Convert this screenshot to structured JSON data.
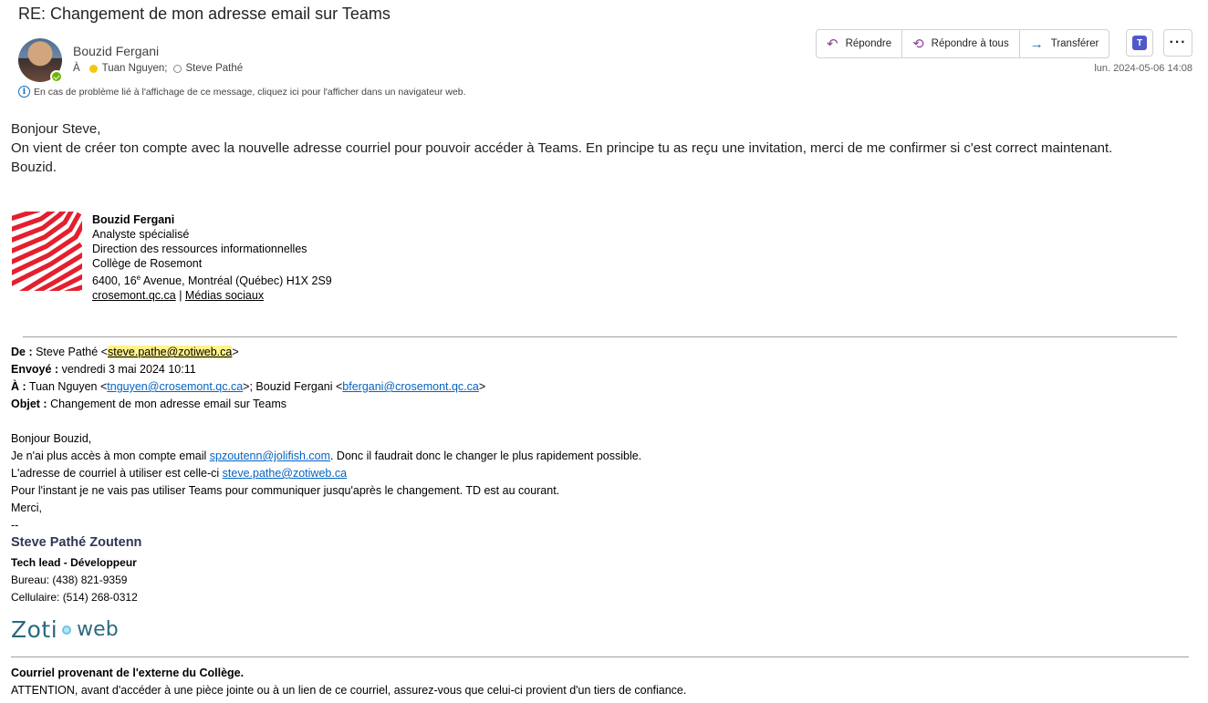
{
  "email": {
    "subject": "RE: Changement de mon adresse email sur Teams",
    "sender_name": "Bouzid Fergani",
    "to_label": "À",
    "recipients": [
      "Tuan Nguyen;",
      "Steve Pathé"
    ],
    "date": "lun. 2024-05-06 14:08",
    "info_banner": "En cas de problème lié à l'affichage de ce message, cliquez ici pour l'afficher dans un navigateur web."
  },
  "actions": {
    "reply": "Répondre",
    "reply_all": "Répondre à tous",
    "forward": "Transférer"
  },
  "body": {
    "greeting": "Bonjour Steve,",
    "line1": "On vient de créer ton compte avec la nouvelle adresse courriel pour pouvoir accéder à Teams. En principe tu as reçu une invitation, merci de me confirmer si c'est correct maintenant.",
    "closing": "Bouzid."
  },
  "signature": {
    "name": "Bouzid Fergani",
    "title": "Analyste spécialisé",
    "department": "Direction des ressources informationnelles",
    "org": "Collège de Rosemont",
    "address_pre": "6400, 16",
    "address_sup": "e",
    "address_post": " Avenue, Montréal (Québec)  H1X 2S9",
    "link_site": "crosemont.qc.ca",
    "separator": " | ",
    "link_social": "Médias sociaux"
  },
  "quoted": {
    "from_label": "De :",
    "from_name": " Steve Pathé <",
    "from_email": "steve.pathe@zotiweb.ca",
    "from_end": ">",
    "sent_label": "Envoyé :",
    "sent_value": " vendredi 3 mai 2024 10:11",
    "to_label": "À :",
    "to_name1": " Tuan Nguyen <",
    "to_email1": "tnguyen@crosemont.qc.ca",
    "to_mid": ">; Bouzid Fergani <",
    "to_email2": "bfergani@crosemont.qc.ca",
    "to_end": ">",
    "subject_label": "Objet :",
    "subject_value": " Changement de mon adresse email sur Teams",
    "greeting": "Bonjour Bouzid,",
    "line1_pre": "Je n'ai plus accès à mon compte email ",
    "line1_email": "spzoutenn@jolifish.com",
    "line1_post": ". Donc il faudrait donc le changer le plus rapidement possible.",
    "line2_pre": "L'adresse de courriel à utiliser est celle-ci ",
    "line2_email": "steve.pathe@zotiweb.ca",
    "line3": "Pour l'instant je ne vais pas utiliser Teams pour communiquer jusqu'après le changement. TD est au courant.",
    "thanks": "Merci,",
    "dashes": "--"
  },
  "signature2": {
    "name": "Steve Pathé Zoutenn",
    "title": "Tech lead - Développeur",
    "office": "Bureau: (438) 821-9359",
    "mobile": "Cellulaire: (514) 268-0312",
    "logo_part1": "Zoti",
    "logo_part2": "web"
  },
  "footer": {
    "heading": "Courriel provenant de l'externe du Collège.",
    "warning": "ATTENTION, avant d'accéder à une pièce jointe ou à un lien de ce courriel, assurez-vous que celui-ci provient d'un tiers de confiance."
  },
  "colors": {
    "accent_purple": "#8f3e97",
    "accent_blue": "#0f6cbd",
    "link": "#0563c1",
    "highlight": "#fff38a",
    "rosemont_red": "#e3202e"
  }
}
